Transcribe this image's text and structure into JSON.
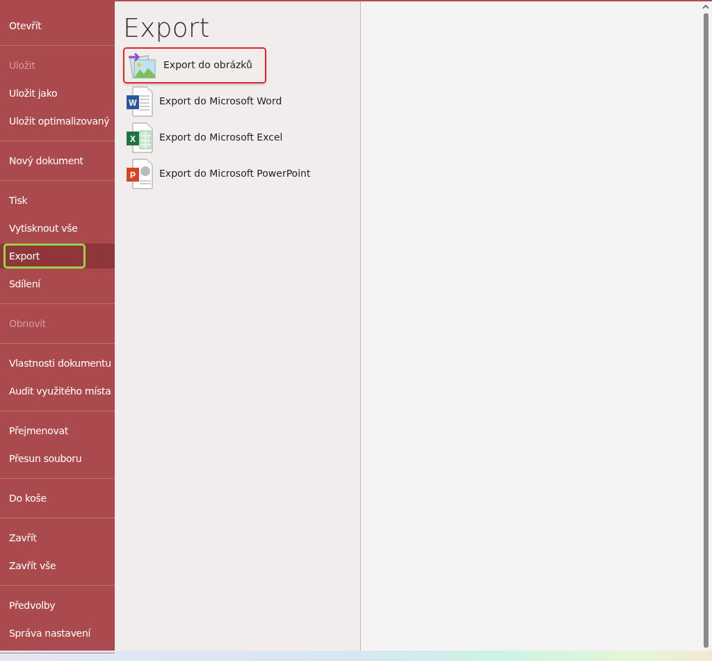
{
  "sidebar": {
    "groups": [
      {
        "items": [
          {
            "label": "Otevřít",
            "disabled": false,
            "selected": false,
            "outlined": false
          }
        ]
      },
      {
        "items": [
          {
            "label": "Uložit",
            "disabled": true,
            "selected": false,
            "outlined": false
          },
          {
            "label": "Uložit jako",
            "disabled": false,
            "selected": false,
            "outlined": false
          },
          {
            "label": "Uložit optimalizovaný",
            "disabled": false,
            "selected": false,
            "outlined": false
          }
        ]
      },
      {
        "items": [
          {
            "label": "Nový dokument",
            "disabled": false,
            "selected": false,
            "outlined": false
          }
        ]
      },
      {
        "items": [
          {
            "label": "Tisk",
            "disabled": false,
            "selected": false,
            "outlined": false
          },
          {
            "label": "Vytisknout vše",
            "disabled": false,
            "selected": false,
            "outlined": false
          },
          {
            "label": "Export",
            "disabled": false,
            "selected": true,
            "outlined": true
          },
          {
            "label": "Sdílení",
            "disabled": false,
            "selected": false,
            "outlined": false
          }
        ]
      },
      {
        "items": [
          {
            "label": "Obnovit",
            "disabled": true,
            "selected": false,
            "outlined": false
          }
        ]
      },
      {
        "items": [
          {
            "label": "Vlastnosti dokumentu",
            "disabled": false,
            "selected": false,
            "outlined": false
          },
          {
            "label": "Audit využitého místa",
            "disabled": false,
            "selected": false,
            "outlined": false
          }
        ]
      },
      {
        "items": [
          {
            "label": "Přejmenovat",
            "disabled": false,
            "selected": false,
            "outlined": false
          },
          {
            "label": "Přesun souboru",
            "disabled": false,
            "selected": false,
            "outlined": false
          }
        ]
      },
      {
        "items": [
          {
            "label": "Do koše",
            "disabled": false,
            "selected": false,
            "outlined": false
          }
        ]
      },
      {
        "items": [
          {
            "label": "Zavřít",
            "disabled": false,
            "selected": false,
            "outlined": false
          },
          {
            "label": "Zavřít vše",
            "disabled": false,
            "selected": false,
            "outlined": false
          }
        ]
      },
      {
        "items": [
          {
            "label": "Předvolby",
            "disabled": false,
            "selected": false,
            "outlined": false
          },
          {
            "label": "Správa nastavení",
            "disabled": false,
            "selected": false,
            "outlined": false
          }
        ]
      }
    ]
  },
  "panel": {
    "title": "Export",
    "options": [
      {
        "kind": "image",
        "label": "Export do obrázků",
        "outlined": true
      },
      {
        "kind": "word",
        "badge": "W",
        "label": "Export do Microsoft Word",
        "outlined": false
      },
      {
        "kind": "excel",
        "badge": "X",
        "label": "Export do Microsoft Excel",
        "outlined": false
      },
      {
        "kind": "powerpoint",
        "badge": "P",
        "label": "Export do Microsoft PowerPoint",
        "outlined": false
      }
    ]
  }
}
